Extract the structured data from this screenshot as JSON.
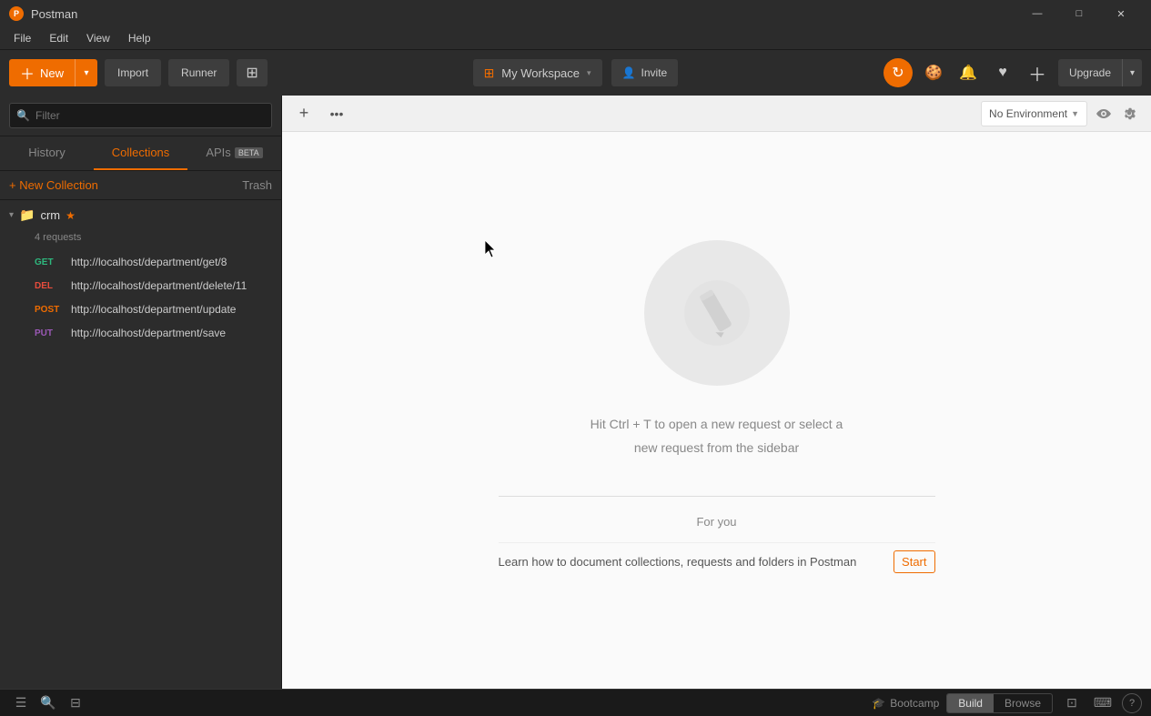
{
  "app": {
    "title": "Postman",
    "logo": "P"
  },
  "titlebar": {
    "title": "Postman",
    "minimize_label": "—",
    "maximize_label": "□",
    "close_label": "✕"
  },
  "menubar": {
    "items": [
      "File",
      "Edit",
      "View",
      "Help"
    ]
  },
  "toolbar": {
    "new_label": "New",
    "import_label": "Import",
    "runner_label": "Runner",
    "workspace_label": "My Workspace",
    "invite_label": "Invite",
    "upgrade_label": "Upgrade"
  },
  "sidebar": {
    "filter_placeholder": "Filter",
    "tabs": [
      {
        "label": "History",
        "active": false
      },
      {
        "label": "Collections",
        "active": true
      },
      {
        "label": "APIs",
        "beta": true,
        "active": false
      }
    ],
    "new_collection_label": "+ New Collection",
    "trash_label": "Trash",
    "collections": [
      {
        "name": "crm",
        "starred": true,
        "request_count": "4 requests",
        "expanded": true,
        "requests": [
          {
            "method": "GET",
            "url": "http://localhost/department/get/8"
          },
          {
            "method": "DEL",
            "url": "http://localhost/department/delete/11"
          },
          {
            "method": "POST",
            "url": "http://localhost/department/update"
          },
          {
            "method": "PUT",
            "url": "http://localhost/department/save"
          }
        ]
      }
    ]
  },
  "tabs_bar": {
    "add_tab_label": "+",
    "more_label": "•••"
  },
  "environment": {
    "label": "No Environment",
    "dropdown_arrow": "▼"
  },
  "empty_state": {
    "hint_line1": "Hit Ctrl + T to open a new request or select a",
    "hint_line2": "new request from the sidebar",
    "for_you_title": "For you",
    "learn_text": "Learn how to document collections, requests and folders in Postman",
    "start_label": "Start"
  },
  "statusbar": {
    "bootcamp_label": "Bootcamp",
    "build_label": "Build",
    "browse_label": "Browse",
    "help_label": "?"
  },
  "icons": {
    "search": "🔍",
    "star": "★",
    "folder": "📁",
    "sync": "↻",
    "invite_person": "👤",
    "bell": "🔔",
    "heart": "♥",
    "cookie": "🍪",
    "wrench": "🔧",
    "cursor": "↖",
    "bootcamp": "🎓"
  }
}
